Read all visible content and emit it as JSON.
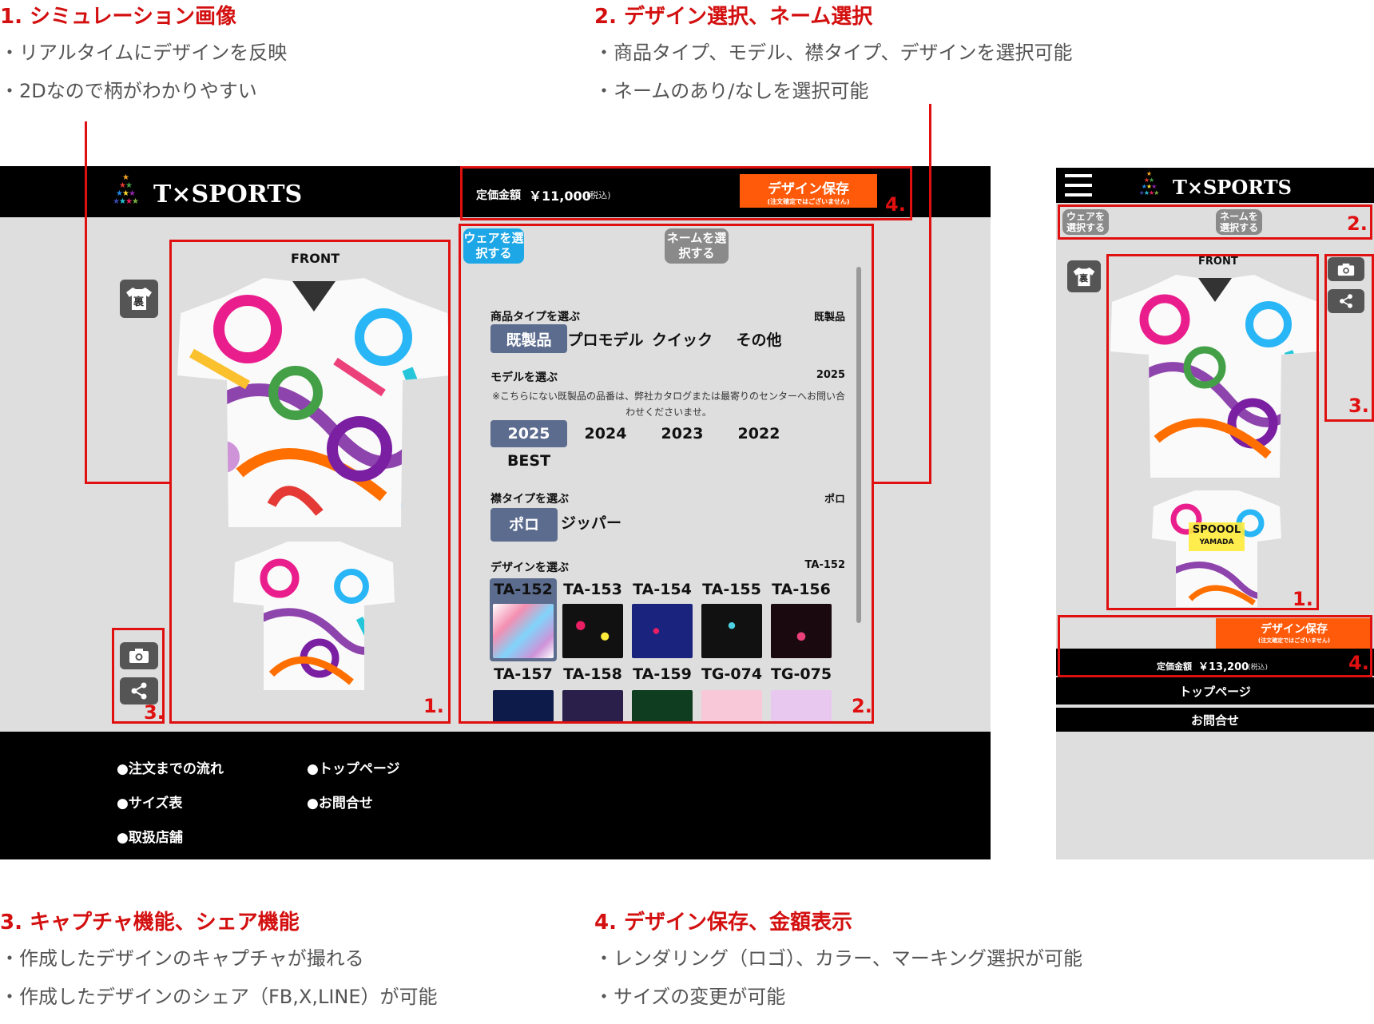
{
  "annotations": {
    "a1": {
      "title": "1. シミュレーション画像",
      "lines": [
        "・リアルタイムにデザインを反映",
        "・2Dなので柄がわかりやすい"
      ]
    },
    "a2": {
      "title": "2. デザイン選択、ネーム選択",
      "lines": [
        "・商品タイプ、モデル、襟タイプ、デザインを選択可能",
        "・ネームのあり/なしを選択可能"
      ]
    },
    "a3": {
      "title": "3. キャプチャ機能、シェア機能",
      "lines": [
        "・作成したデザインのキャプチャが撮れる",
        "・作成したデザインのシェア（FB,X,LINE）が可能"
      ]
    },
    "a4": {
      "title": "4. デザイン保存、金額表示",
      "lines": [
        "・レンダリング（ロゴ）、カラー、マーキング選択が可能",
        "・サイズの変更が可能"
      ]
    }
  },
  "box_numbers": {
    "n1": "1.",
    "n2": "2.",
    "n3": "3.",
    "n4": "4."
  },
  "desktop": {
    "logo": "T×SPORTS",
    "price_label": "定価金額",
    "price_value": "￥11,000",
    "tax_note": "(税込)",
    "save_button": "デザイン保存",
    "save_note": "(注文確定ではございません)",
    "back_icon_label": "裏",
    "front_label": "FRONT",
    "wear_button": "ウェアを選択する",
    "name_button": "ネームを選択する",
    "product_type": {
      "label": "商品タイプを選ぶ",
      "value": "既製品",
      "options": [
        "既製品",
        "プロモデル",
        "クイック",
        "その他"
      ],
      "selected": "既製品"
    },
    "model": {
      "label": "モデルを選ぶ",
      "value": "2025",
      "note": "※こちらにない既製品の品番は、弊社カタログまたは最寄りのセンターへお問い合わせくださいませ。",
      "options": [
        "2025",
        "2024",
        "2023",
        "2022",
        "BEST"
      ],
      "selected": "2025"
    },
    "collar": {
      "label": "襟タイプを選ぶ",
      "value": "ポロ",
      "options": [
        "ポロ",
        "ジッパー"
      ],
      "selected": "ポロ"
    },
    "design": {
      "label": "デザインを選ぶ",
      "value": "TA-152",
      "row1": [
        "TA-152",
        "TA-153",
        "TA-154",
        "TA-155",
        "TA-156"
      ],
      "row2": [
        "TA-157",
        "TA-158",
        "TA-159",
        "TG-074",
        "TG-075"
      ],
      "selected": "TA-152"
    },
    "footer": [
      "●注文までの流れ",
      "●トップページ",
      "●サイズ表",
      "●お問合せ",
      "●取扱店舗"
    ]
  },
  "mobile": {
    "logo": "T×SPORTS",
    "wear_button": "ウェアを選択する",
    "name_button": "ネームを選択する",
    "front_label": "FRONT",
    "back_icon_label": "裏",
    "save_button": "デザイン保存",
    "save_note": "(注文確定ではございません)",
    "price_label": "定価金額",
    "price_value": "￥13,200",
    "tax_note": "(税込)",
    "footer": [
      "トップページ",
      "お問合せ"
    ],
    "shirt_name_top": "SPOOOL",
    "shirt_name_bottom": "YAMADA"
  },
  "colors": {
    "accent_red": "#e01010",
    "save_orange": "#ff5a0a",
    "wear_blue": "#1ea7e6",
    "selected_navy": "#5c6c8e"
  }
}
